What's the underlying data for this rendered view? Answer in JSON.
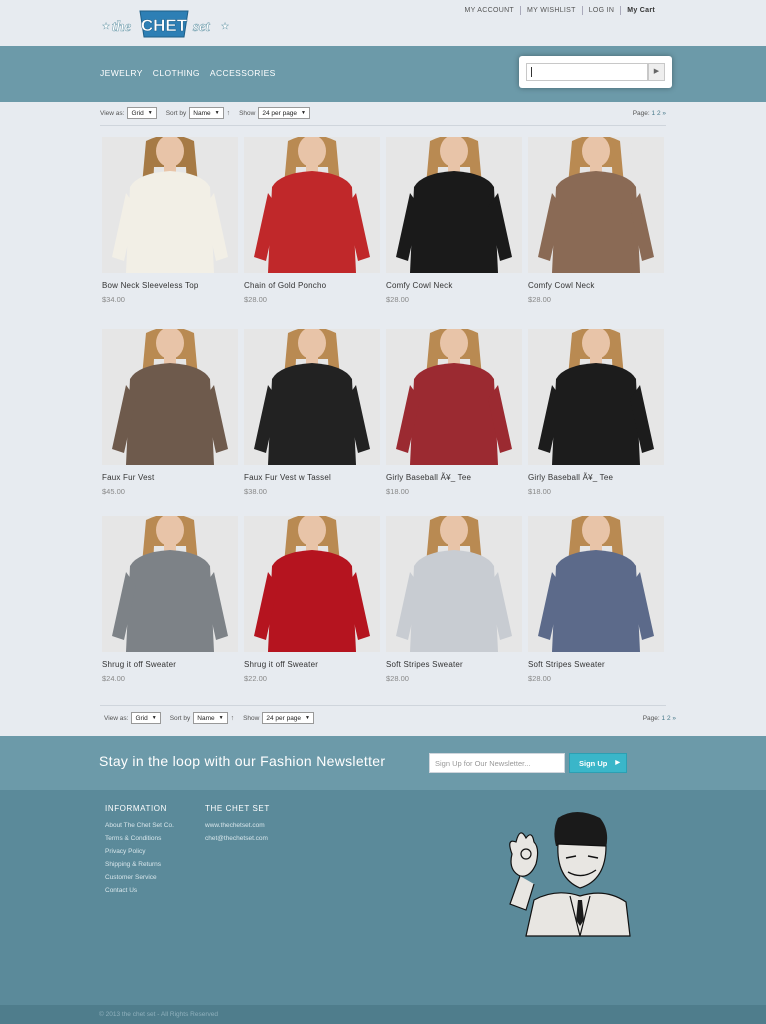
{
  "brand": {
    "logo_text_left": "the",
    "logo_text_mid": "CHET",
    "logo_text_right": "set"
  },
  "top_links": [
    "MY ACCOUNT",
    "MY WISHLIST",
    "LOG IN",
    "My Cart"
  ],
  "nav": [
    "JEWELRY",
    "CLOTHING",
    "ACCESSORIES"
  ],
  "search": {
    "value": "",
    "button_icon": "play-arrow-icon"
  },
  "toolbar": {
    "view_label": "View as:",
    "view_value": "Grid",
    "sort_label": "Sort by",
    "sort_value": "Name",
    "sort_dir": "↑",
    "show_label": "Show",
    "show_value": "24 per page",
    "page_label": "Page:",
    "pages": "1 2 »"
  },
  "products": [
    {
      "name": "Bow Neck Sleeveless Top",
      "price": "$34.00",
      "top": "#f2efe6",
      "hair": "#a67a45",
      "skin": "#e8c4a8"
    },
    {
      "name": "Chain of Gold Poncho",
      "price": "$28.00",
      "top": "#c0282a",
      "hair": "#b98a52",
      "skin": "#e8c4a8"
    },
    {
      "name": "Comfy Cowl Neck",
      "price": "$28.00",
      "top": "#1a1a1a",
      "hair": "#b98a52",
      "skin": "#e8c4a8"
    },
    {
      "name": "Comfy Cowl Neck",
      "price": "$28.00",
      "top": "#8a6a55",
      "hair": "#b98a52",
      "skin": "#e8c4a8"
    },
    {
      "name": "Faux Fur Vest",
      "price": "$45.00",
      "top": "#6e5a4c",
      "hair": "#b98a52",
      "skin": "#e8c4a8"
    },
    {
      "name": "Faux Fur Vest w Tassel",
      "price": "$38.00",
      "top": "#222222",
      "hair": "#b98a52",
      "skin": "#e8c4a8"
    },
    {
      "name": "Girly Baseball Ã¥_ Tee",
      "price": "$18.00",
      "top": "#9b2a31",
      "hair": "#b98a52",
      "skin": "#e8c4a8"
    },
    {
      "name": "Girly Baseball Ã¥_ Tee",
      "price": "$18.00",
      "top": "#1c1c1c",
      "hair": "#b98a52",
      "skin": "#e8c4a8"
    },
    {
      "name": "Shrug it off Sweater",
      "price": "$24.00",
      "top": "#7d8287",
      "hair": "#b98a52",
      "skin": "#e8c4a8"
    },
    {
      "name": "Shrug it off Sweater",
      "price": "$22.00",
      "top": "#b5141f",
      "hair": "#b98a52",
      "skin": "#e8c4a8"
    },
    {
      "name": "Soft Stripes Sweater",
      "price": "$28.00",
      "top": "#c8ccd2",
      "hair": "#b98a52",
      "skin": "#e8c4a8"
    },
    {
      "name": "Soft Stripes Sweater",
      "price": "$28.00",
      "top": "#5c6a8a",
      "hair": "#b98a52",
      "skin": "#e8c4a8"
    }
  ],
  "newsletter": {
    "title": "Stay in the loop with our Fashion Newsletter",
    "placeholder": "Sign Up for Our Newsletter...",
    "button": "Sign Up"
  },
  "footer": {
    "col1_title": "INFORMATION",
    "col1_links": [
      "About The Chet Set Co.",
      "Terms & Conditions",
      "Privacy Policy",
      "Shipping & Returns",
      "Customer Service",
      "Contact Us"
    ],
    "col2_title": "THE CHET SET",
    "col2_links": [
      "www.thechetset.com",
      "chet@thechetset.com"
    ],
    "copyright": "© 2013 the chet set - All Rights Reserved"
  },
  "colors": {
    "band": "#6c9aa9",
    "footer": "#5b8a9a",
    "accent": "#3ab6c9"
  }
}
